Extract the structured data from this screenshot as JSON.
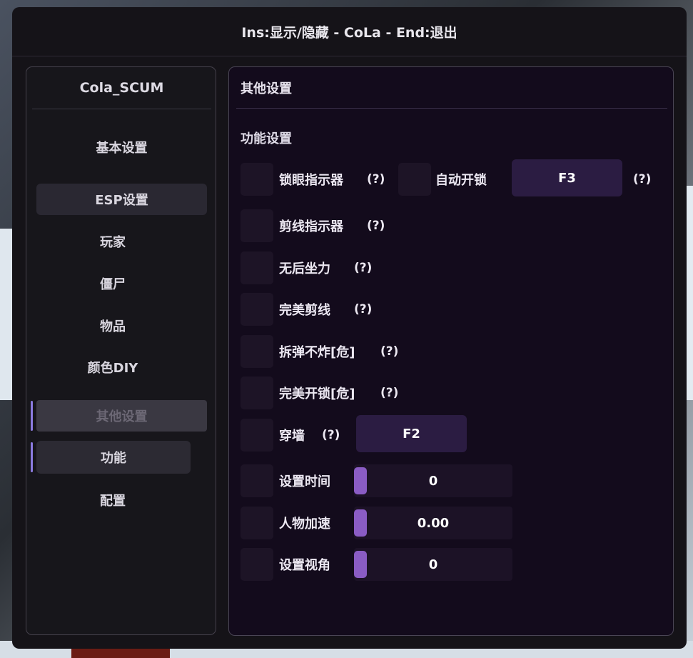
{
  "window": {
    "title": "Ins:显示/隐藏 - CoLa - End:退出"
  },
  "sidebar": {
    "title": "Cola_SCUM",
    "items": [
      {
        "label": "基本设置"
      },
      {
        "label": "ESP设置"
      },
      {
        "label": "玩家"
      },
      {
        "label": "僵尸"
      },
      {
        "label": "物品"
      },
      {
        "label": "颜色DIY"
      },
      {
        "label": "其他设置"
      },
      {
        "label": "功能"
      },
      {
        "label": "配置"
      }
    ]
  },
  "main": {
    "header": "其他设置",
    "section": "功能设置",
    "features": [
      {
        "label": "锁眼指示器",
        "help": "(?)"
      },
      {
        "label": "自动开锁",
        "help": "(?)",
        "key": "F3"
      },
      {
        "label": "剪线指示器",
        "help": "(?)"
      },
      {
        "label": "无后坐力",
        "help": "(?)"
      },
      {
        "label": "完美剪线",
        "help": "(?)"
      },
      {
        "label": "拆弹不炸[危]",
        "help": "(?)"
      },
      {
        "label": "完美开锁[危]",
        "help": "(?)"
      },
      {
        "label": "穿墙",
        "help": "(?)",
        "key": "F2"
      }
    ],
    "sliders": [
      {
        "label": "设置时间",
        "value": "0"
      },
      {
        "label": "人物加速",
        "value": "0.00"
      },
      {
        "label": "设置视角",
        "value": "0"
      }
    ]
  },
  "colors": {
    "accent": "#8b7be0",
    "slider_grab": "#8a5cc4",
    "key_button": "#2b1c42",
    "panel_bg": "#130b1c"
  }
}
